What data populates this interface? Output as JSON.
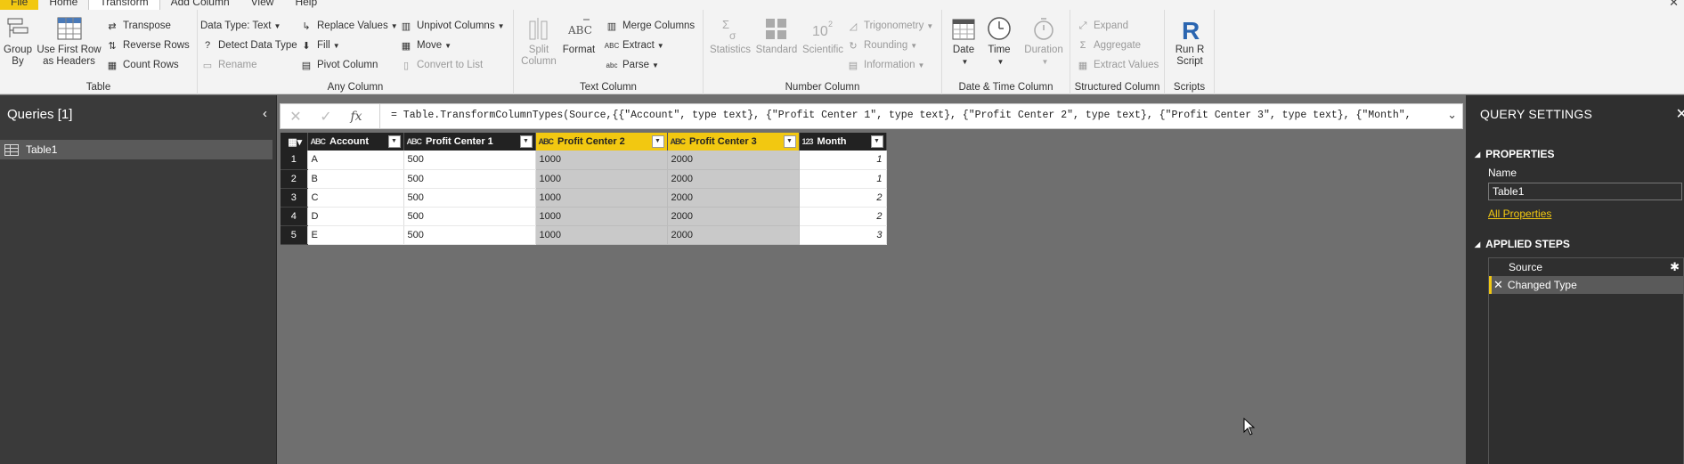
{
  "menubar": {
    "tabs": [
      "File",
      "Home",
      "Transform",
      "Add Column",
      "View",
      "Help"
    ],
    "active_tab": "Transform"
  },
  "ribbon": {
    "table_group": {
      "label": "Table",
      "group_by": "Group\nBy",
      "use_first_row": "Use First Row\nas Headers",
      "transpose": "Transpose",
      "reverse_rows": "Reverse Rows",
      "count_rows": "Count Rows"
    },
    "any_column_group": {
      "label": "Any Column",
      "data_type": "Data Type: Text",
      "detect_data_type": "Detect Data Type",
      "rename": "Rename",
      "replace_values": "Replace Values",
      "fill": "Fill",
      "pivot_column": "Pivot Column",
      "unpivot_columns": "Unpivot Columns",
      "move": "Move",
      "convert_to_list": "Convert to List"
    },
    "text_column_group": {
      "label": "Text Column",
      "split_column": "Split\nColumn",
      "format": "Format",
      "merge_columns": "Merge Columns",
      "extract": "Extract",
      "parse": "Parse"
    },
    "number_column_group": {
      "label": "Number Column",
      "statistics": "Statistics",
      "standard": "Standard",
      "scientific": "Scientific",
      "trigonometry": "Trigonometry",
      "rounding": "Rounding",
      "information": "Information"
    },
    "datetime_group": {
      "label": "Date & Time Column",
      "date": "Date",
      "time": "Time",
      "duration": "Duration"
    },
    "structured_group": {
      "label": "Structured Column",
      "expand": "Expand",
      "aggregate": "Aggregate",
      "extract_values": "Extract Values"
    },
    "scripts_group": {
      "label": "Scripts",
      "run_r_script": "Run R\nScript"
    }
  },
  "queries_pane": {
    "title": "Queries [1]",
    "items": [
      "Table1"
    ]
  },
  "formula_bar": {
    "formula": "= Table.TransformColumnTypes(Source,{{\"Account\", type text}, {\"Profit Center 1\", type text}, {\"Profit Center 2\", type text}, {\"Profit Center 3\", type text}, {\"Month\","
  },
  "table": {
    "columns": [
      {
        "name": "Account",
        "type_icon": "ABC",
        "selected": false
      },
      {
        "name": "Profit Center 1",
        "type_icon": "ABC",
        "selected": false
      },
      {
        "name": "Profit Center 2",
        "type_icon": "ABC",
        "selected": true
      },
      {
        "name": "Profit Center 3",
        "type_icon": "ABC",
        "selected": true
      },
      {
        "name": "Month",
        "type_icon": "123",
        "selected": false
      }
    ],
    "rows": [
      {
        "n": "1",
        "cells": [
          "A",
          "500",
          "1000",
          "2000",
          "1"
        ]
      },
      {
        "n": "2",
        "cells": [
          "B",
          "500",
          "1000",
          "2000",
          "1"
        ]
      },
      {
        "n": "3",
        "cells": [
          "C",
          "500",
          "1000",
          "2000",
          "2"
        ]
      },
      {
        "n": "4",
        "cells": [
          "D",
          "500",
          "1000",
          "2000",
          "2"
        ]
      },
      {
        "n": "5",
        "cells": [
          "E",
          "500",
          "1000",
          "2000",
          "3"
        ]
      }
    ]
  },
  "query_settings": {
    "title": "QUERY SETTINGS",
    "properties_label": "PROPERTIES",
    "name_label": "Name",
    "name_value": "Table1",
    "all_properties": "All Properties",
    "applied_steps_label": "APPLIED STEPS",
    "steps": [
      "Source",
      "Changed Type"
    ]
  },
  "colors": {
    "accent": "#f2c811",
    "selected_cell": "#c9c9c9",
    "grid_bg": "#6f6f6f"
  }
}
